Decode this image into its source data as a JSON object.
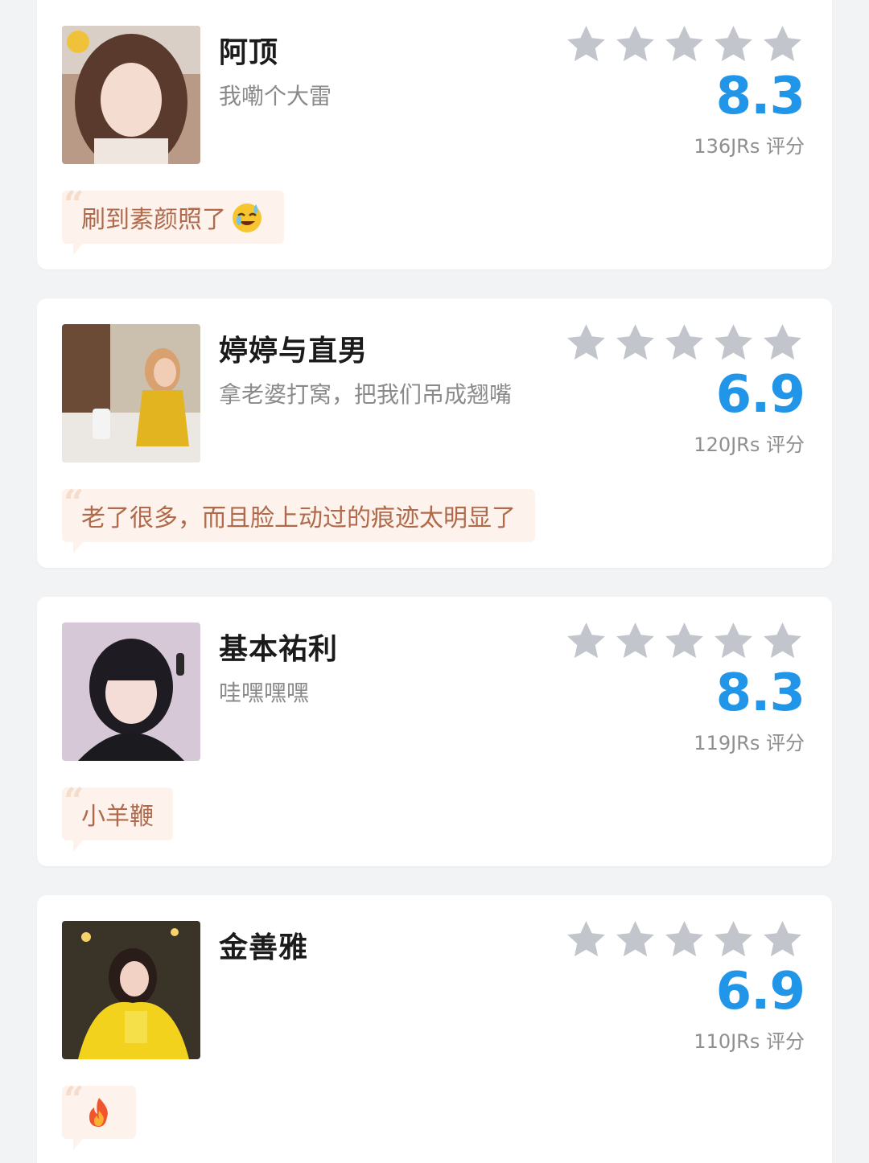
{
  "colors": {
    "score": "#2196e8",
    "star": "#c2c6cc",
    "comment_bg": "#fdf3ec",
    "comment_text": "#b0694a"
  },
  "entries": [
    {
      "name": "阿顶",
      "subtitle": "我嘞个大雷",
      "score": "8.3",
      "rating_count": "136JRs 评分",
      "comment": "刷到素颜照了",
      "comment_emoji": "sweat-laugh-emoji"
    },
    {
      "name": "婷婷与直男",
      "subtitle": "拿老婆打窝，把我们吊成翘嘴",
      "score": "6.9",
      "rating_count": "120JRs 评分",
      "comment": "老了很多，而且脸上动过的痕迹太明显了"
    },
    {
      "name": "基本祐利",
      "subtitle": "哇嘿嘿嘿",
      "score": "8.3",
      "rating_count": "119JRs 评分",
      "comment": "小羊鞭"
    },
    {
      "name": "金善雅",
      "subtitle": "",
      "score": "6.9",
      "rating_count": "110JRs 评分",
      "comment": "",
      "comment_emoji": "fire-emoji"
    }
  ]
}
